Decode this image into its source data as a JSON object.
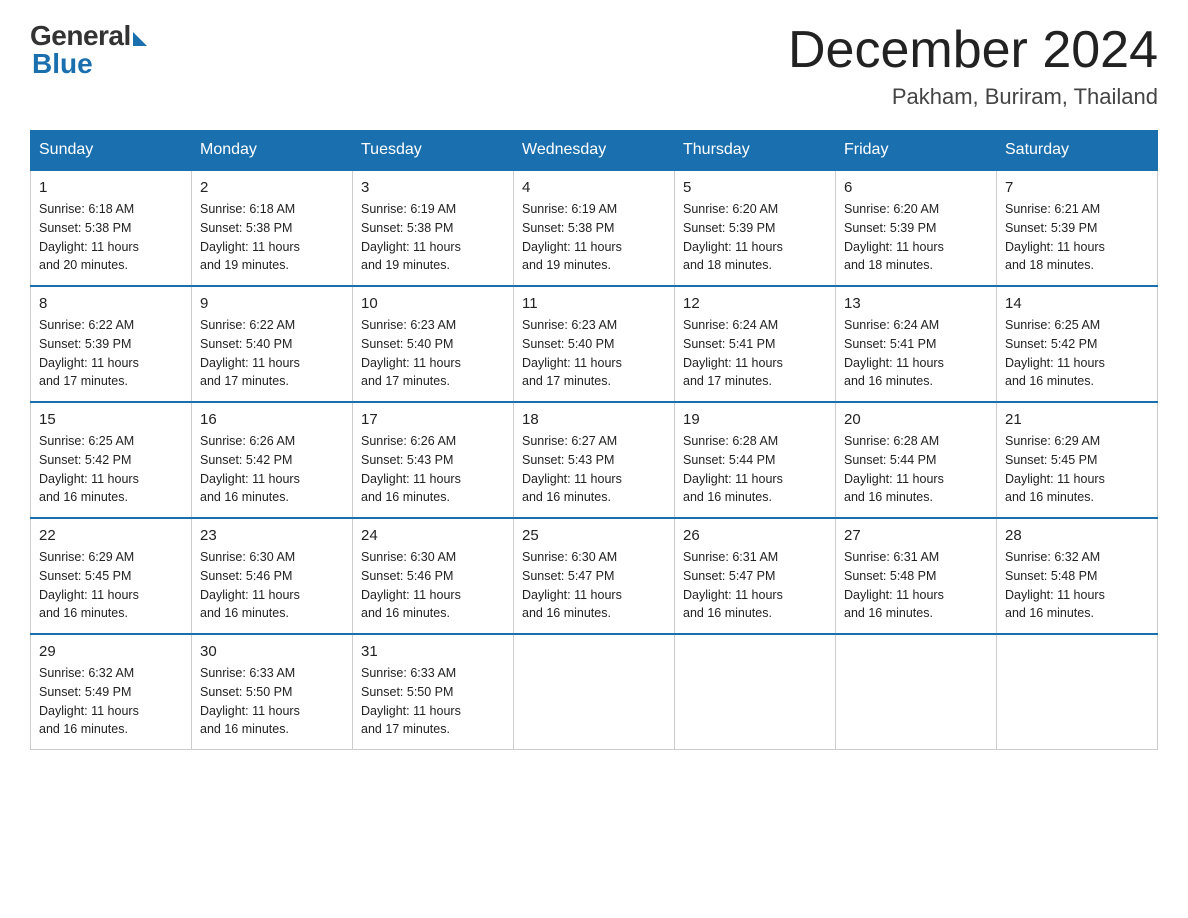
{
  "logo": {
    "text_general": "General",
    "text_blue": "Blue"
  },
  "header": {
    "month_title": "December 2024",
    "location": "Pakham, Buriram, Thailand"
  },
  "weekdays": [
    "Sunday",
    "Monday",
    "Tuesday",
    "Wednesday",
    "Thursday",
    "Friday",
    "Saturday"
  ],
  "weeks": [
    [
      {
        "day": "1",
        "sunrise": "6:18 AM",
        "sunset": "5:38 PM",
        "daylight": "11 hours and 20 minutes."
      },
      {
        "day": "2",
        "sunrise": "6:18 AM",
        "sunset": "5:38 PM",
        "daylight": "11 hours and 19 minutes."
      },
      {
        "day": "3",
        "sunrise": "6:19 AM",
        "sunset": "5:38 PM",
        "daylight": "11 hours and 19 minutes."
      },
      {
        "day": "4",
        "sunrise": "6:19 AM",
        "sunset": "5:38 PM",
        "daylight": "11 hours and 19 minutes."
      },
      {
        "day": "5",
        "sunrise": "6:20 AM",
        "sunset": "5:39 PM",
        "daylight": "11 hours and 18 minutes."
      },
      {
        "day": "6",
        "sunrise": "6:20 AM",
        "sunset": "5:39 PM",
        "daylight": "11 hours and 18 minutes."
      },
      {
        "day": "7",
        "sunrise": "6:21 AM",
        "sunset": "5:39 PM",
        "daylight": "11 hours and 18 minutes."
      }
    ],
    [
      {
        "day": "8",
        "sunrise": "6:22 AM",
        "sunset": "5:39 PM",
        "daylight": "11 hours and 17 minutes."
      },
      {
        "day": "9",
        "sunrise": "6:22 AM",
        "sunset": "5:40 PM",
        "daylight": "11 hours and 17 minutes."
      },
      {
        "day": "10",
        "sunrise": "6:23 AM",
        "sunset": "5:40 PM",
        "daylight": "11 hours and 17 minutes."
      },
      {
        "day": "11",
        "sunrise": "6:23 AM",
        "sunset": "5:40 PM",
        "daylight": "11 hours and 17 minutes."
      },
      {
        "day": "12",
        "sunrise": "6:24 AM",
        "sunset": "5:41 PM",
        "daylight": "11 hours and 17 minutes."
      },
      {
        "day": "13",
        "sunrise": "6:24 AM",
        "sunset": "5:41 PM",
        "daylight": "11 hours and 16 minutes."
      },
      {
        "day": "14",
        "sunrise": "6:25 AM",
        "sunset": "5:42 PM",
        "daylight": "11 hours and 16 minutes."
      }
    ],
    [
      {
        "day": "15",
        "sunrise": "6:25 AM",
        "sunset": "5:42 PM",
        "daylight": "11 hours and 16 minutes."
      },
      {
        "day": "16",
        "sunrise": "6:26 AM",
        "sunset": "5:42 PM",
        "daylight": "11 hours and 16 minutes."
      },
      {
        "day": "17",
        "sunrise": "6:26 AM",
        "sunset": "5:43 PM",
        "daylight": "11 hours and 16 minutes."
      },
      {
        "day": "18",
        "sunrise": "6:27 AM",
        "sunset": "5:43 PM",
        "daylight": "11 hours and 16 minutes."
      },
      {
        "day": "19",
        "sunrise": "6:28 AM",
        "sunset": "5:44 PM",
        "daylight": "11 hours and 16 minutes."
      },
      {
        "day": "20",
        "sunrise": "6:28 AM",
        "sunset": "5:44 PM",
        "daylight": "11 hours and 16 minutes."
      },
      {
        "day": "21",
        "sunrise": "6:29 AM",
        "sunset": "5:45 PM",
        "daylight": "11 hours and 16 minutes."
      }
    ],
    [
      {
        "day": "22",
        "sunrise": "6:29 AM",
        "sunset": "5:45 PM",
        "daylight": "11 hours and 16 minutes."
      },
      {
        "day": "23",
        "sunrise": "6:30 AM",
        "sunset": "5:46 PM",
        "daylight": "11 hours and 16 minutes."
      },
      {
        "day": "24",
        "sunrise": "6:30 AM",
        "sunset": "5:46 PM",
        "daylight": "11 hours and 16 minutes."
      },
      {
        "day": "25",
        "sunrise": "6:30 AM",
        "sunset": "5:47 PM",
        "daylight": "11 hours and 16 minutes."
      },
      {
        "day": "26",
        "sunrise": "6:31 AM",
        "sunset": "5:47 PM",
        "daylight": "11 hours and 16 minutes."
      },
      {
        "day": "27",
        "sunrise": "6:31 AM",
        "sunset": "5:48 PM",
        "daylight": "11 hours and 16 minutes."
      },
      {
        "day": "28",
        "sunrise": "6:32 AM",
        "sunset": "5:48 PM",
        "daylight": "11 hours and 16 minutes."
      }
    ],
    [
      {
        "day": "29",
        "sunrise": "6:32 AM",
        "sunset": "5:49 PM",
        "daylight": "11 hours and 16 minutes."
      },
      {
        "day": "30",
        "sunrise": "6:33 AM",
        "sunset": "5:50 PM",
        "daylight": "11 hours and 16 minutes."
      },
      {
        "day": "31",
        "sunrise": "6:33 AM",
        "sunset": "5:50 PM",
        "daylight": "11 hours and 17 minutes."
      },
      null,
      null,
      null,
      null
    ]
  ],
  "labels": {
    "sunrise": "Sunrise:",
    "sunset": "Sunset:",
    "daylight": "Daylight:"
  }
}
